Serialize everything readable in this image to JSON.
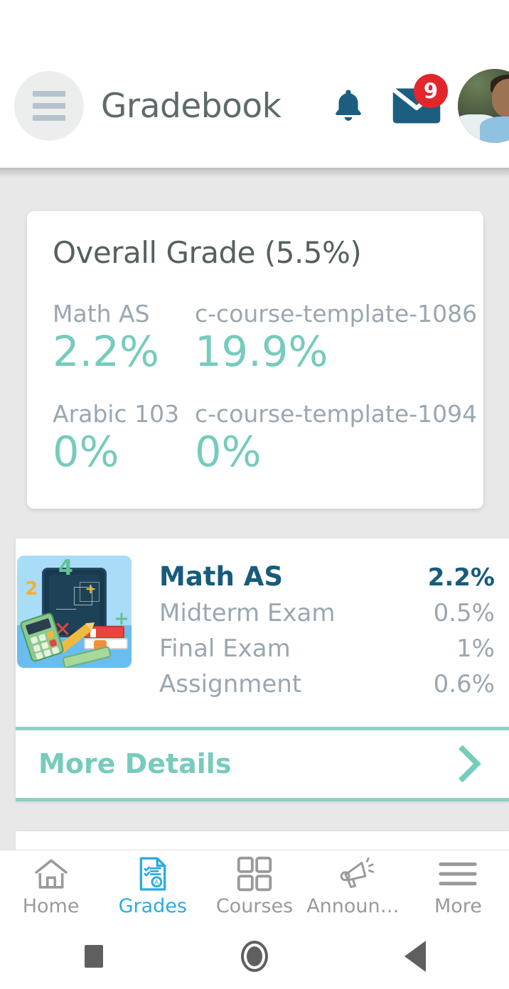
{
  "appbar": {
    "menu_icon": "hamburger-menu-icon",
    "title": "Gradebook",
    "bell_icon": "notification-bell-icon",
    "mail_icon": "envelope-icon",
    "mail_badge": "9",
    "avatar_icon": "user-avatar"
  },
  "overall": {
    "title": "Overall Grade (5.5%)",
    "courses": [
      {
        "name": "Math AS",
        "value": "2.2%"
      },
      {
        "name": "c-course-template-1086",
        "value": "19.9%"
      },
      {
        "name": "Arabic 103",
        "value": "0%"
      },
      {
        "name": "c-course-template-1094",
        "value": "0%"
      }
    ]
  },
  "course_card": {
    "thumbnail_icon": "math-course-thumbnail",
    "name": "Math AS",
    "total": "2.2%",
    "items": [
      {
        "label": "Midterm Exam",
        "value": "0.5%"
      },
      {
        "label": "Final Exam",
        "value": "1%"
      },
      {
        "label": "Assignment",
        "value": "0.6%"
      }
    ],
    "more_details_label": "More Details",
    "chevron_icon": "chevron-right-icon"
  },
  "bottom_nav": {
    "items": [
      {
        "label": "Home",
        "icon": "home-icon",
        "active": false
      },
      {
        "label": "Grades",
        "icon": "graded-document-icon",
        "active": true
      },
      {
        "label": "Courses",
        "icon": "grid-squares-icon",
        "active": false
      },
      {
        "label": "Announce...",
        "icon": "megaphone-icon",
        "active": false
      },
      {
        "label": "More",
        "icon": "hamburger-menu-icon",
        "active": false
      }
    ]
  },
  "system_nav": {
    "recents_icon": "square-recents-icon",
    "home_icon": "circle-home-icon",
    "back_icon": "triangle-back-icon"
  },
  "colors": {
    "teal": "#76cbbd",
    "navy": "#175b7d",
    "accent_blue": "#29abe2",
    "muted": "#9aa7b0",
    "badge_red": "#e3262b",
    "page_bg": "#e8e8e8"
  }
}
